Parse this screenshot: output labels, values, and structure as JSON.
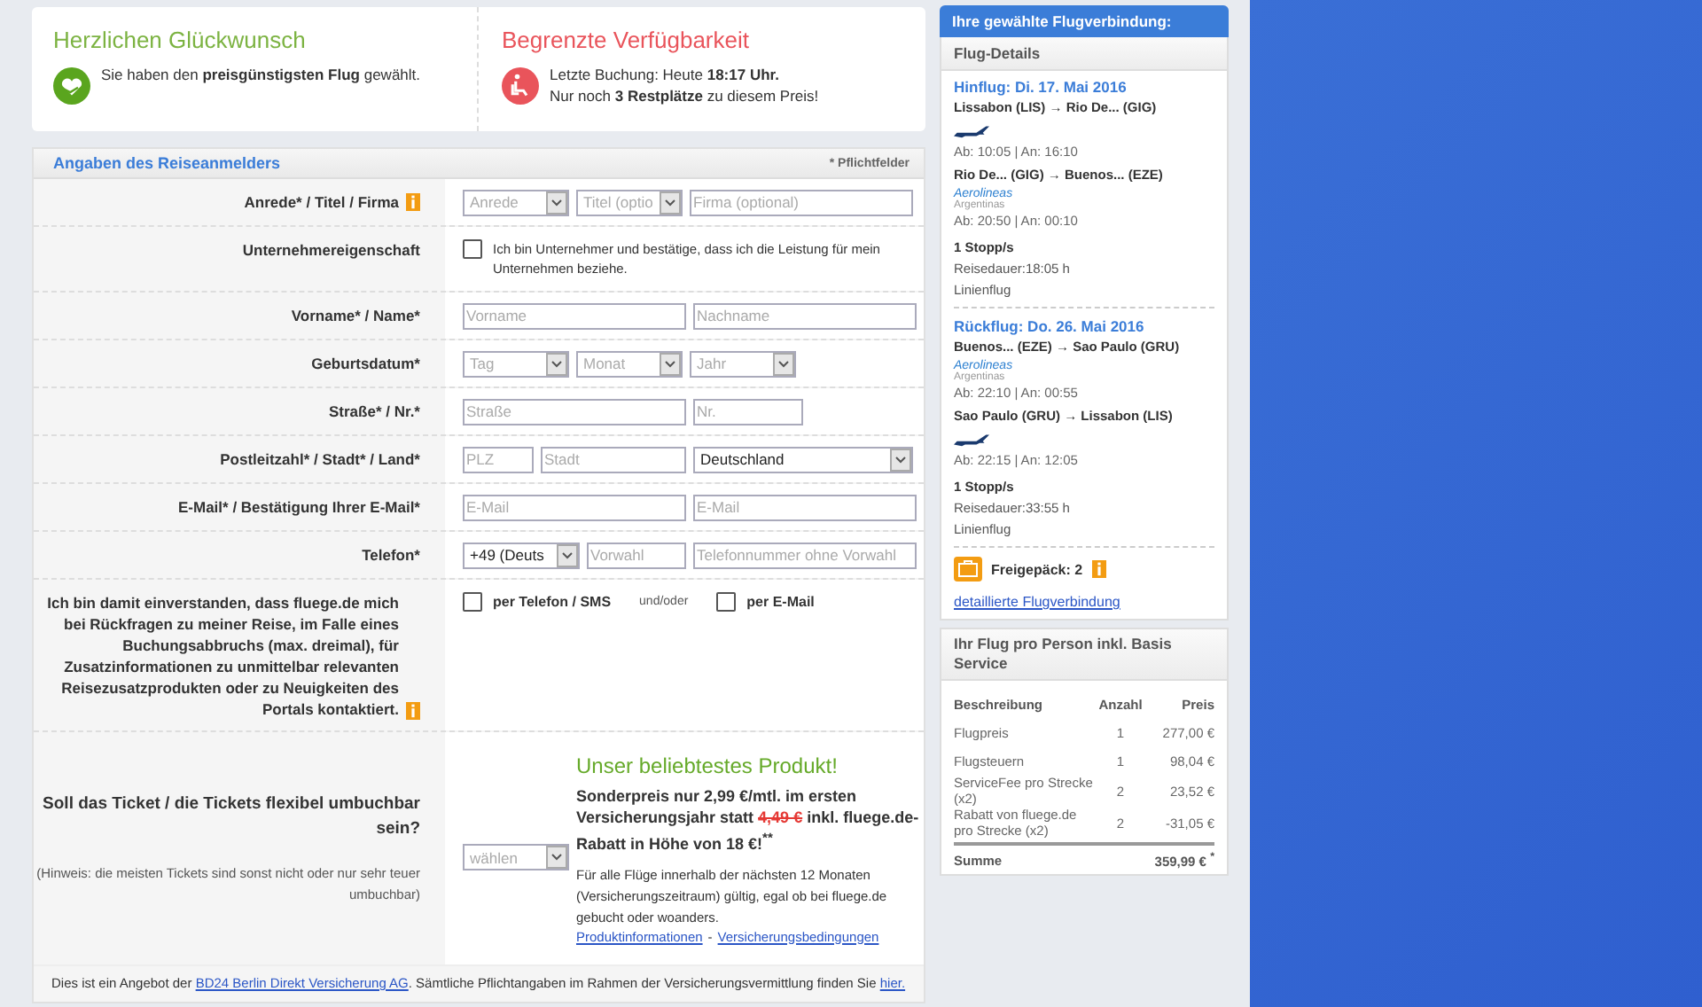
{
  "notices": [
    {
      "kind": "success",
      "title": "Herzlichen Glückwunsch",
      "lines": [
        "Sie haben den **preisgünstigsten Flug** gewählt."
      ]
    },
    {
      "kind": "warning",
      "title": "Begrenzte Verfügbarkeit",
      "lines": [
        "Letzte Buchung: Heute **18:17 Uhr.**",
        "Nur noch **3 Restplätze** zu diesem Preis!"
      ]
    }
  ],
  "form": {
    "title": "Angaben des Reiseanmelders",
    "required_note": "* Pflichtfelder",
    "rows": [
      {
        "kind": "fields",
        "label": "Anrede*  / Titel / Firma",
        "info": true,
        "fields": [
          {
            "kind": "select",
            "placeholder": "Anrede"
          },
          {
            "kind": "select",
            "placeholder": "Titel (optio"
          },
          {
            "kind": "input",
            "placeholder": "Firma (optional)"
          }
        ]
      },
      {
        "kind": "checkbox",
        "label": "Unternehmereigenschaft",
        "info": false,
        "checked": false,
        "text": "Ich bin Unternehmer und bestätige, dass ich die Leistung für mein Unternehmen beziehe."
      },
      {
        "kind": "fields",
        "label": "Vorname* / Name*",
        "info": false,
        "fields": [
          {
            "kind": "input",
            "placeholder": "Vorname"
          },
          {
            "kind": "input",
            "placeholder": "Nachname"
          }
        ]
      },
      {
        "kind": "fields",
        "label": "Geburtsdatum*",
        "info": false,
        "fields": [
          {
            "kind": "select",
            "placeholder": "Tag"
          },
          {
            "kind": "select",
            "placeholder": "Monat"
          },
          {
            "kind": "select",
            "placeholder": "Jahr"
          }
        ]
      },
      {
        "kind": "fields",
        "label": "Straße* / Nr.*",
        "info": false,
        "fields": [
          {
            "kind": "input",
            "placeholder": "Straße"
          },
          {
            "kind": "input",
            "placeholder": "Nr."
          }
        ]
      },
      {
        "kind": "fields",
        "label": "Postleitzahl* / Stadt* / Land*",
        "info": false,
        "fields": [
          {
            "kind": "input",
            "placeholder": "PLZ"
          },
          {
            "kind": "input",
            "placeholder": "Stadt"
          },
          {
            "kind": "select",
            "value": "Deutschland"
          }
        ]
      },
      {
        "kind": "fields",
        "label": "E-Mail* / Bestätigung Ihrer E-Mail*",
        "info": false,
        "fields": [
          {
            "kind": "input",
            "placeholder": "E-Mail"
          },
          {
            "kind": "input",
            "placeholder": "E-Mail"
          }
        ]
      },
      {
        "kind": "fields",
        "label": "Telefon*",
        "info": false,
        "fields": [
          {
            "kind": "select",
            "value": "+49 (Deuts"
          },
          {
            "kind": "input",
            "placeholder": "Vorwahl"
          },
          {
            "kind": "input",
            "placeholder": "Telefonnummer ohne Vorwahl"
          }
        ]
      },
      {
        "kind": "consent",
        "label": "Ich bin damit einverstanden, dass fluege.de mich bei Rückfragen zu meiner Reise, im Falle eines Buchungsabbruchs (max. dreimal), für Zusatzinformationen zu unmittelbar relevanten Reisezusatzprodukten oder zu Neuigkeiten des Portals kontaktiert.",
        "info": true,
        "separator": "und/oder",
        "options": [
          {
            "label": "per Telefon / SMS",
            "checked": false
          },
          {
            "label": "per E-Mail",
            "checked": false
          }
        ]
      },
      {
        "kind": "offer",
        "label": "Soll das Ticket / die Tickets flexibel umbuchbar sein?",
        "info": false,
        "hint": "(Hinweis: die meisten Tickets sind sonst nicht oder nur sehr teuer umbuchbar)",
        "select": {
          "placeholder": "wählen"
        },
        "offer_title": "Unser beliebtestes Produkt!",
        "offer_before": "Sonderpreis nur 2,99 €/mtl. im ersten Versicherungsjahr statt",
        "old_price": "4,49 €",
        "offer_after": "inkl. fluege.de-Rabatt in Höhe von 18 €!$^{**}$",
        "description": "Für alle Flüge innerhalb der nächsten 12 Monaten (Versicherungszeitraum) gültig, egal ob bei fluege.de gebucht oder woanders.",
        "links": [
          "Produktinformationen",
          "Versicherungsbedingungen"
        ],
        "link_separator": "-"
      }
    ],
    "footer": {
      "text_1": "Dies ist ein Angebot der",
      "link_1": "BD24 Berlin Direkt Versicherung AG",
      "text_2": ". Sämtliche Pflichtangaben im Rahmen der Versicherungsvermittlung finden Sie",
      "link_2": "hier."
    }
  },
  "sidebar": {
    "title": "Ihre gewählte Flugverbindung:",
    "tab": "Flug-Details",
    "legs": [
      {
        "heading": "Hinflug: Di. 17. Mai 2016",
        "segments": [
          {
            "route": "Lissabon (LIS) → Rio De... (GIG)",
            "kind": "plane",
            "times": "Ab: 10:05 | An: 16:10"
          },
          {
            "route": "Rio De... (GIG) → Buenos... (EZE)",
            "kind": "logo",
            "logo_name": "Aerolineas",
            "logo_sub": "Argentinas",
            "times": "Ab: 20:50 | An: 00:10"
          }
        ],
        "stops": "1 Stopp/s",
        "duration": "Reisedauer:18:05 h",
        "type": "Linienflug"
      },
      {
        "heading": "Rückflug: Do. 26. Mai 2016",
        "segments": [
          {
            "route": "Buenos... (EZE) → Sao Paulo (GRU)",
            "kind": "logo",
            "logo_name": "Aerolineas",
            "logo_sub": "Argentinas",
            "times": "Ab: 22:10 | An: 00:55"
          },
          {
            "route": "Sao Paulo (GRU) → Lissabon (LIS)",
            "kind": "plane",
            "times": "Ab: 22:15 | An: 12:05"
          }
        ],
        "stops": "1 Stopp/s",
        "duration": "Reisedauer:33:55 h",
        "type": "Linienflug"
      }
    ],
    "baggage": "Freigepäck: 2",
    "details_link": "detaillierte Flugverbindung",
    "price": {
      "title": "Ihr Flug pro Person inkl. Basis Service",
      "columns": [
        "Beschreibung",
        "Anzahl",
        "Preis"
      ],
      "rows": [
        [
          "Flugpreis",
          "1",
          "277,00 €"
        ],
        [
          "Flugsteuern",
          "1",
          "98,04 €"
        ],
        [
          "ServiceFee pro Strecke (x2)",
          "2",
          "23,52 €"
        ],
        [
          "Rabatt von fluege.de pro Strecke (x2)",
          "2",
          "-31,05 €"
        ]
      ],
      "total_label": "Summe",
      "total_value": "359,99 € $^{*}$"
    }
  }
}
